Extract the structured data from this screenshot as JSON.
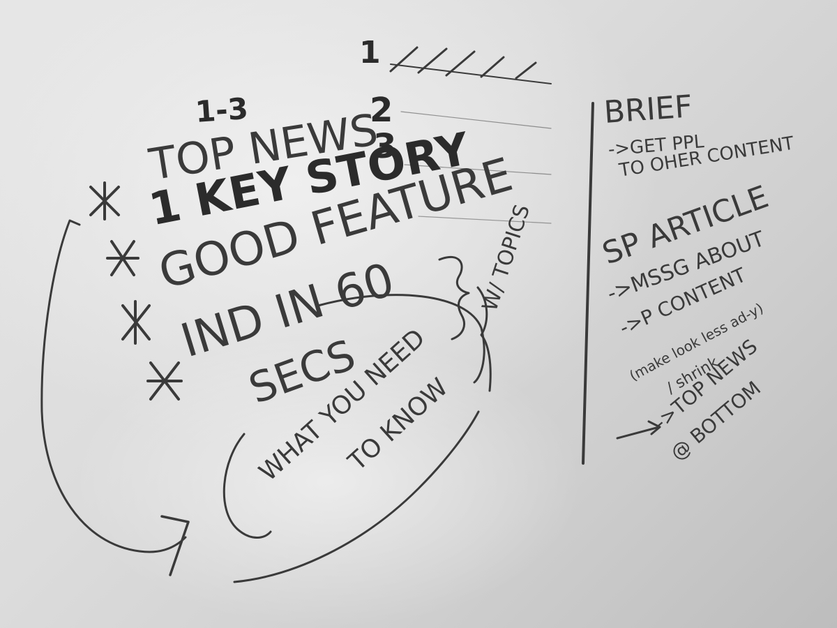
{
  "left_section": {
    "range_label": "1-3",
    "numbers": [
      "1",
      "2",
      "3"
    ],
    "items": [
      {
        "marker": "*",
        "text": "TOP NEWS"
      },
      {
        "marker": "*",
        "text": "1 KEY STORY"
      },
      {
        "marker": "*",
        "text": "GOOD FEATURE"
      },
      {
        "marker": "*",
        "text": "IND IN 60"
      }
    ],
    "item_continuation": "SECS",
    "brace_label": "W/ TOPICS",
    "loop_line1": "WHAT YOU NEED",
    "loop_line2": "TO KNOW"
  },
  "right_section": {
    "brief_title": "BRIEF",
    "brief_line1": "->GET PPL",
    "brief_line2": "TO OHER CONTENT",
    "article_title": "SP ARTICLE",
    "article_line1": "->MSSG ABOUT",
    "article_line2": "->P CONTENT",
    "article_note1": "(make look less ad-y)",
    "article_note2": "/ shrink",
    "article_line3": "->TOP NEWS",
    "article_line4": "@ BOTTOM"
  }
}
